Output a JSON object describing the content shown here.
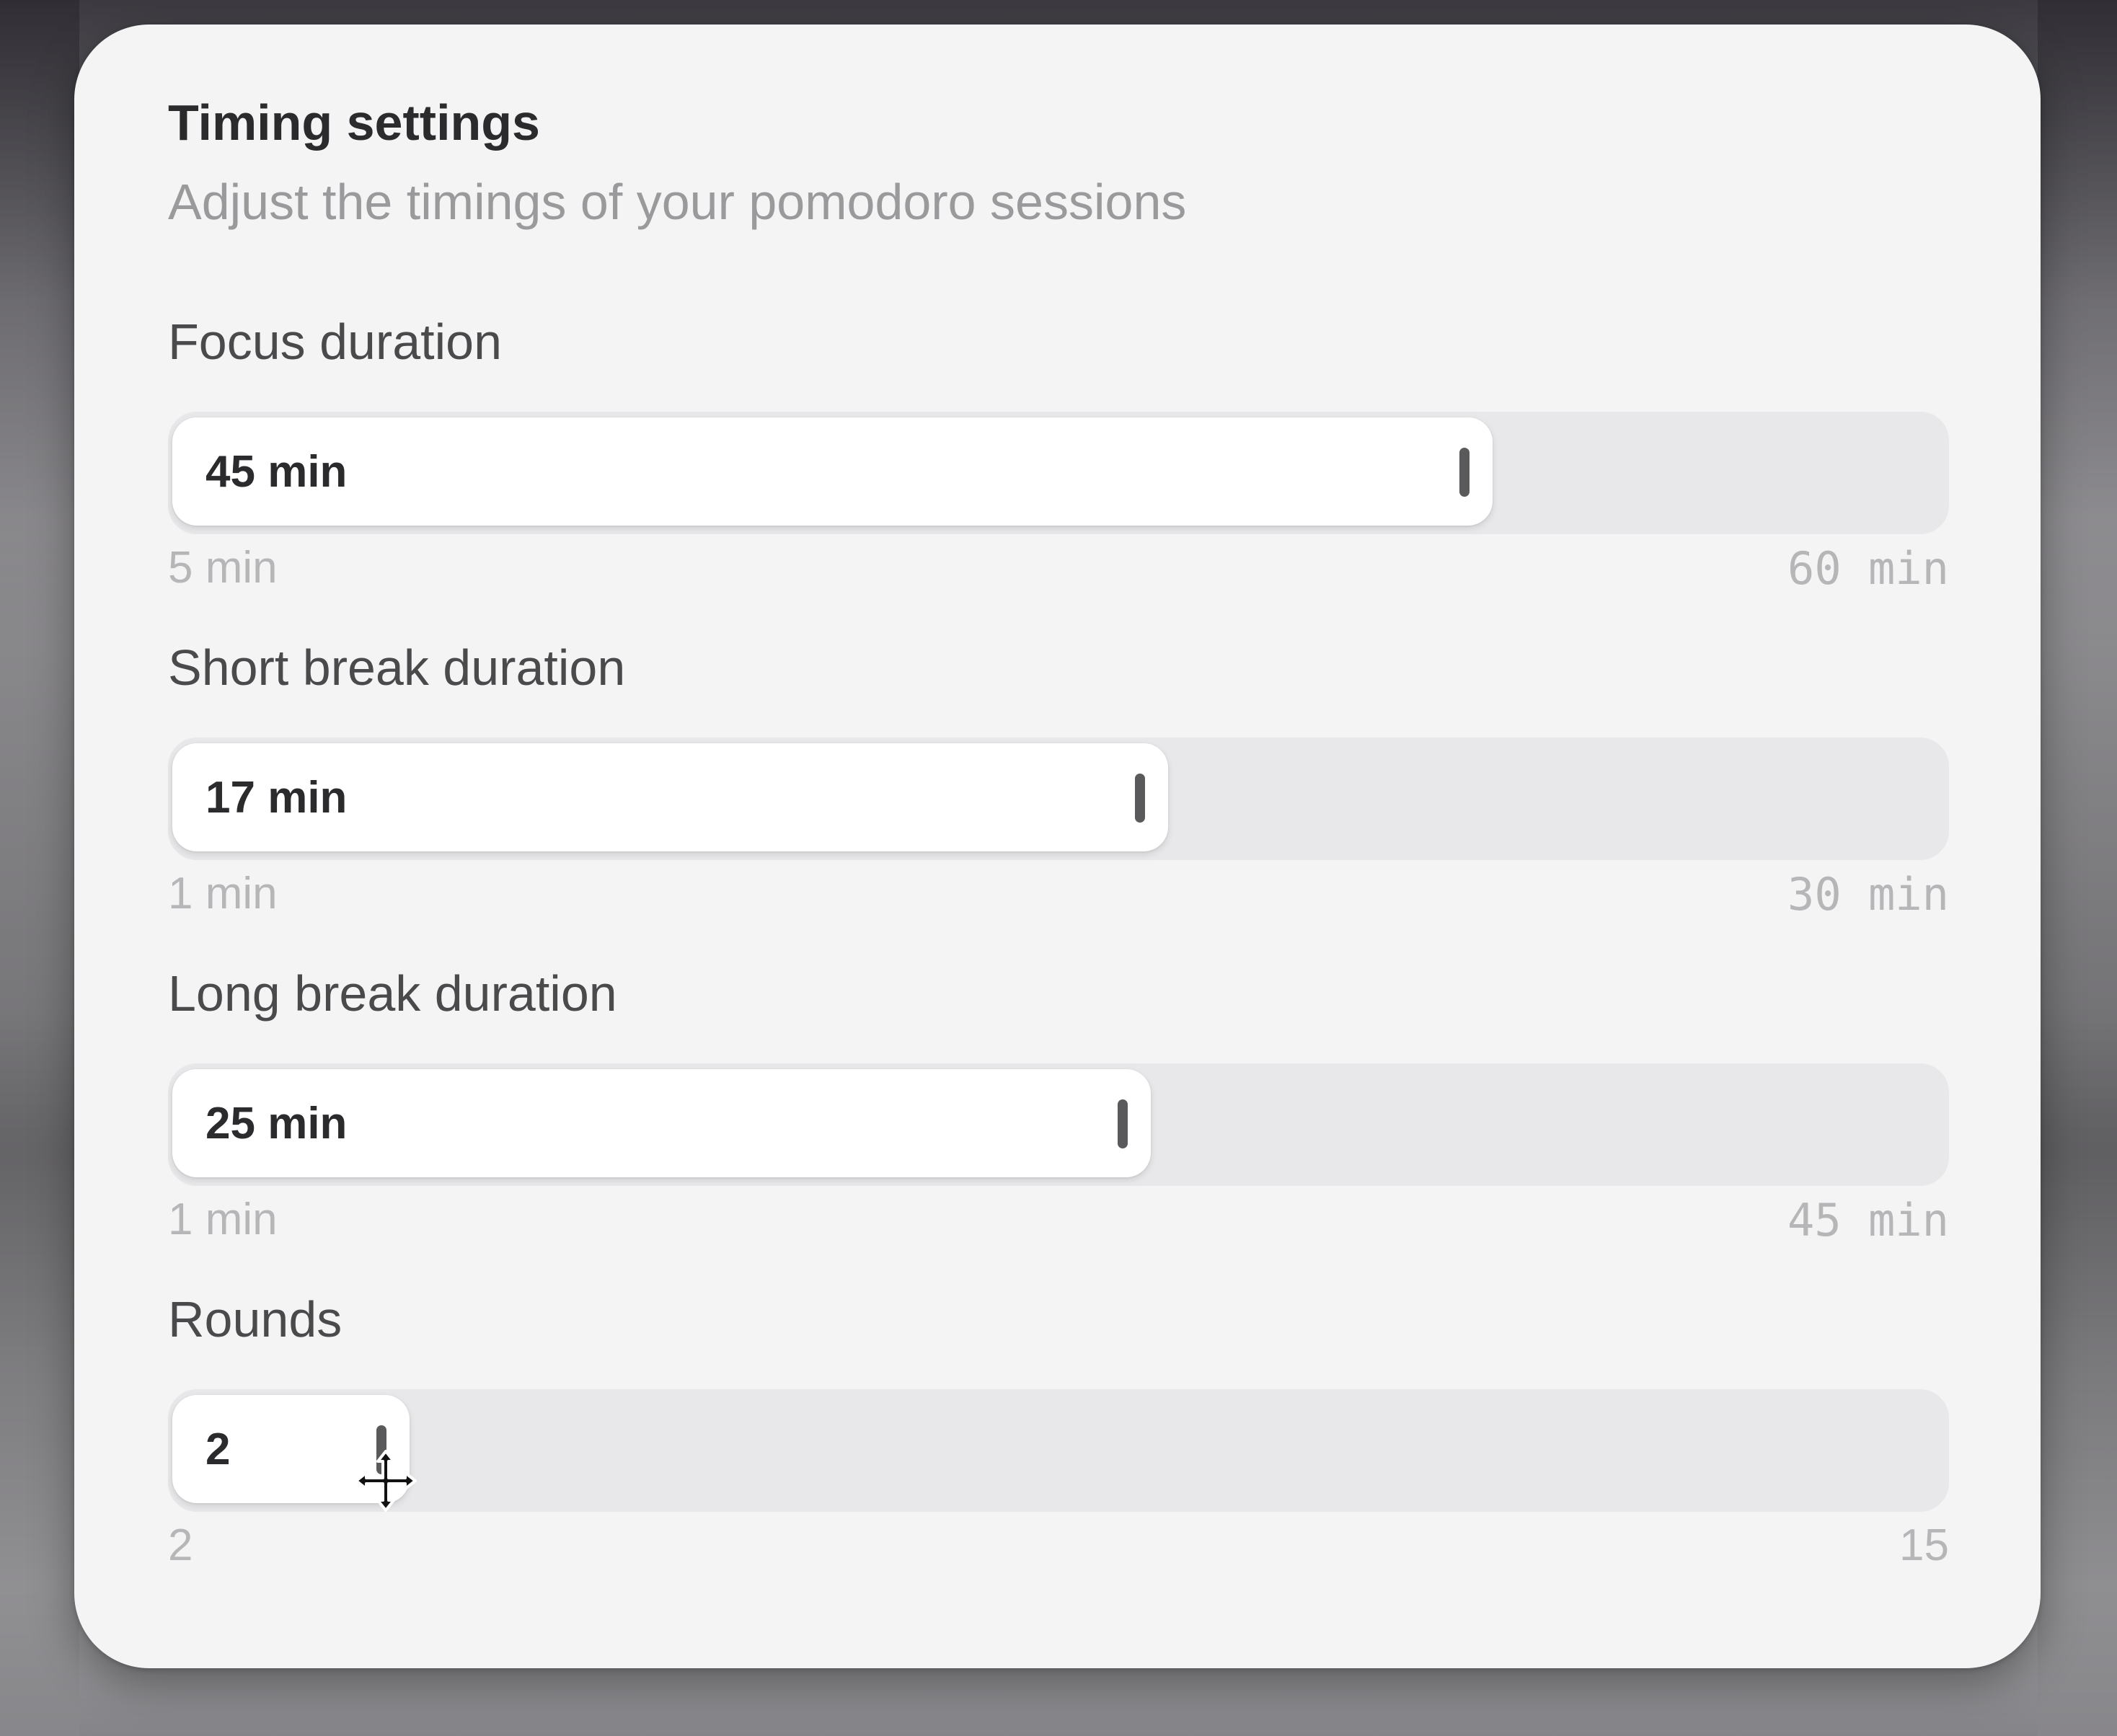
{
  "panel": {
    "title": "Timing settings",
    "subtitle": "Adjust the timings of your pomodoro sessions"
  },
  "settings": [
    {
      "label": "Focus duration",
      "value_text": "45 min",
      "min_text": "5 min",
      "max_text": "60 min",
      "value": 45,
      "min": 5,
      "max": 60,
      "fill_fraction": 0.745
    },
    {
      "label": "Short break duration",
      "value_text": "17 min",
      "min_text": "1 min",
      "max_text": "30 min",
      "value": 17,
      "min": 1,
      "max": 30,
      "fill_fraction": 0.562
    },
    {
      "label": "Long break duration",
      "value_text": "25 min",
      "min_text": "1 min",
      "max_text": "45 min",
      "value": 25,
      "min": 1,
      "max": 45,
      "fill_fraction": 0.552
    },
    {
      "label": "Rounds",
      "value_text": "2",
      "min_text": "2",
      "max_text": "15",
      "value": 2,
      "min": 2,
      "max": 15,
      "fill_fraction": 0.134
    }
  ],
  "cursor": {
    "icon": "move-cursor-icon"
  },
  "colors": {
    "panel_bg": "#f4f4f5",
    "track_bg": "#e8e8ea",
    "fill_bg": "#ffffff",
    "title": "#2b2b2d",
    "subtitle": "#9a9a9d",
    "range_text": "#b6b6b9"
  }
}
